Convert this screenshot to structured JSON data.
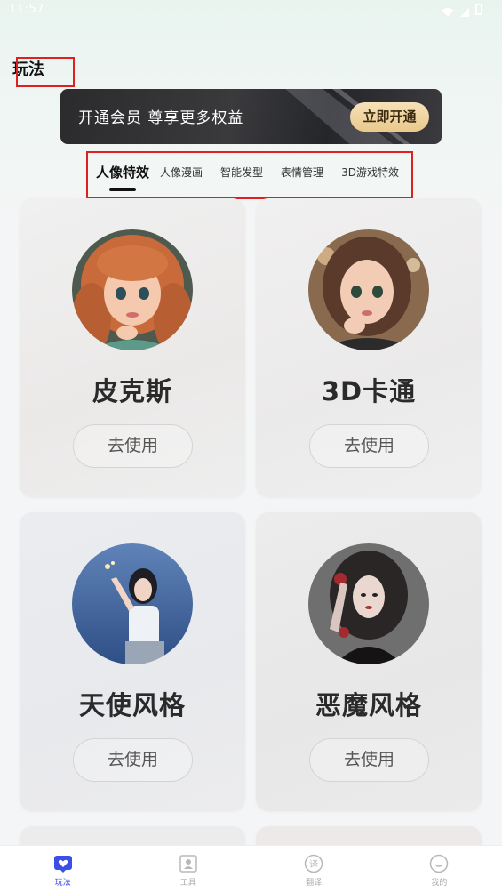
{
  "status_bar": {
    "time": "11:57"
  },
  "page": {
    "title": "玩法"
  },
  "vip_banner": {
    "text": "开通会员 尊享更多权益",
    "button": "立即开通"
  },
  "tabs": [
    {
      "label": "人像特效",
      "active": true
    },
    {
      "label": "人像漫画",
      "active": false
    },
    {
      "label": "智能发型",
      "active": false
    },
    {
      "label": "表情管理",
      "active": false
    },
    {
      "label": "3D游戏特效",
      "active": false
    }
  ],
  "cards": [
    {
      "name": "皮克斯",
      "button": "去使用",
      "avatar": "pixar-girl-avatar"
    },
    {
      "name": "3D卡通",
      "button": "去使用",
      "avatar": "3d-cartoon-girl-avatar"
    },
    {
      "name": "天使风格",
      "button": "去使用",
      "avatar": "angel-style-avatar"
    },
    {
      "name": "恶魔风格",
      "button": "去使用",
      "avatar": "demon-style-avatar"
    }
  ],
  "bottom_nav": [
    {
      "label": "玩法",
      "icon": "heart-chat-icon",
      "active": true
    },
    {
      "label": "工具",
      "icon": "portrait-frame-icon",
      "active": false
    },
    {
      "label": "翻译",
      "icon": "translate-icon",
      "active": false
    },
    {
      "label": "我的",
      "icon": "smile-icon",
      "active": false
    }
  ],
  "colors": {
    "accent": "#3b4ee6",
    "vip_button": "#efd5a2",
    "banner_bg": "#2e2e31",
    "highlight_box": "#e02020"
  }
}
